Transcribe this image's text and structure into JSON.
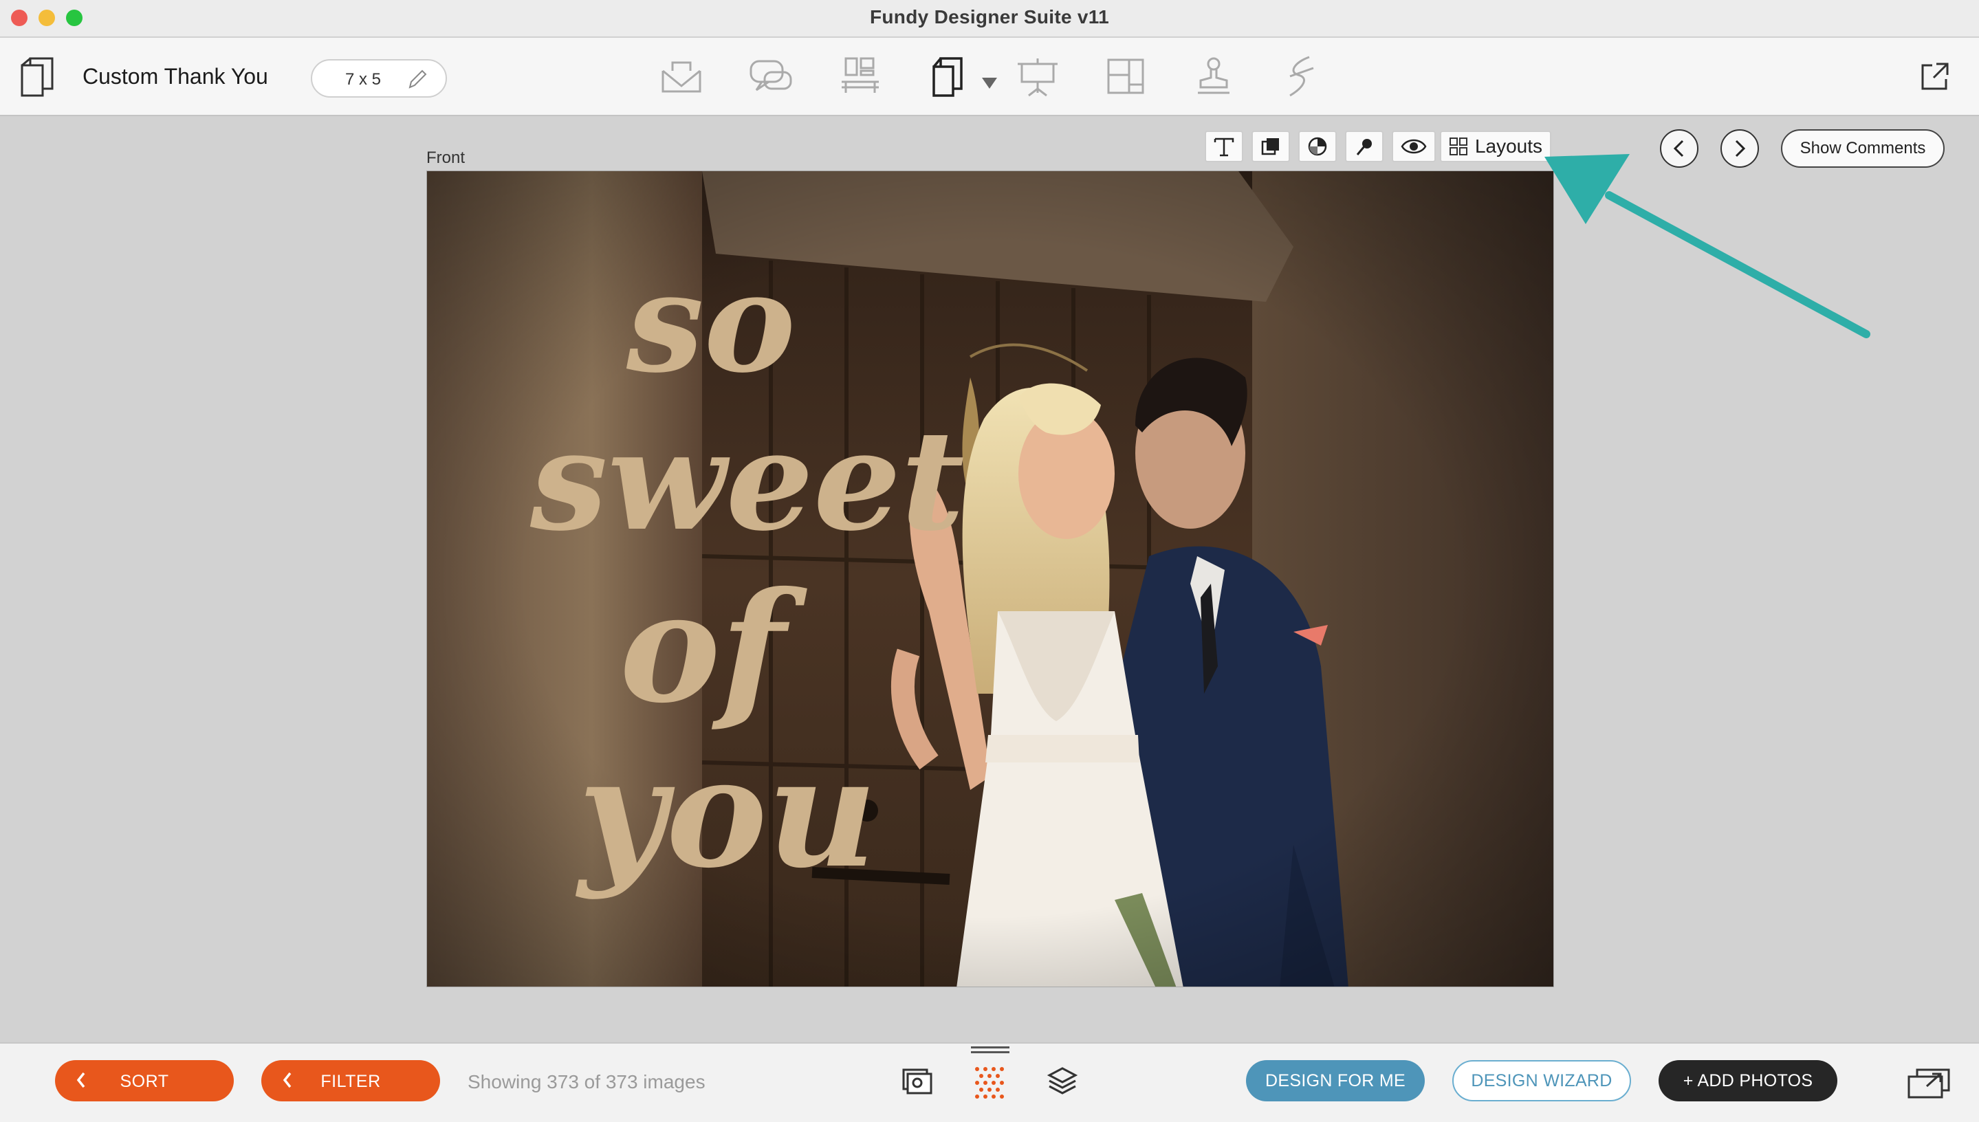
{
  "window": {
    "title": "Fundy Designer Suite v11",
    "traffic_colors": [
      "#ee5b55",
      "#f4bd3a",
      "#27c540"
    ]
  },
  "toolbar": {
    "project_title": "Custom Thank You",
    "size_value": "7 x 5",
    "icons": [
      "album-icon",
      "speech-bubble-icon",
      "wall-art-icon",
      "card-icon",
      "presentation-icon",
      "layout-icon",
      "stamp-icon",
      "signature-icon"
    ],
    "active_icon": "card-icon"
  },
  "canvas": {
    "side_label": "Front",
    "overlay_text": [
      "so",
      "sweet",
      "of",
      "you"
    ],
    "tools": [
      "text-tool-icon",
      "layer-tool-icon",
      "color-tool-icon",
      "eyedropper-tool-icon",
      "preview-eye-icon"
    ],
    "layouts_label": "Layouts",
    "show_comments_label": "Show Comments"
  },
  "colors": {
    "accent_orange": "#e8571c",
    "accent_blue": "#4e95b9",
    "annotation_teal": "#2eaea8",
    "overlay_text": "#cdb28c"
  },
  "bottombar": {
    "sort_label": "SORT",
    "filter_label": "FILTER",
    "showing_text": "Showing 373 of 373 images",
    "design_for_me_label": "DESIGN FOR ME",
    "design_wizard_label": "DESIGN WIZARD",
    "add_photos_label": "+ ADD PHOTOS"
  }
}
